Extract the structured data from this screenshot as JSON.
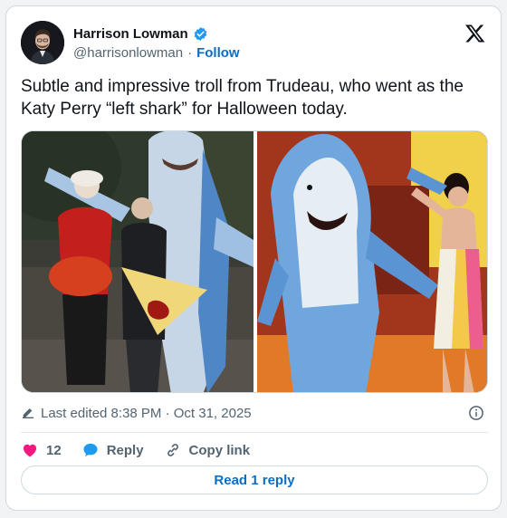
{
  "author": {
    "name": "Harrison Lowman",
    "handle": "@harrisonlowman",
    "separator": "·",
    "follow_label": "Follow",
    "verified_color": "#1d9bf0"
  },
  "tweet": {
    "text": "Subtle and impressive troll from Trudeau, who went as the Katy Perry “left shark” for Halloween today."
  },
  "meta": {
    "edited": "Last edited 8:38 PM · Oct 31, 2025"
  },
  "actions": {
    "like_count": "12",
    "reply_label": "Reply",
    "copy_link_label": "Copy link"
  },
  "footer": {
    "read_replies_label": "Read 1 reply"
  },
  "colors": {
    "accent": "#0a6ec7",
    "heart": "#f91880",
    "reply_bubble": "#1d9bf0"
  },
  "icons": [
    "verified-badge-icon",
    "x-logo-icon",
    "pencil-icon",
    "info-icon",
    "heart-icon",
    "reply-bubble-icon",
    "link-icon"
  ]
}
